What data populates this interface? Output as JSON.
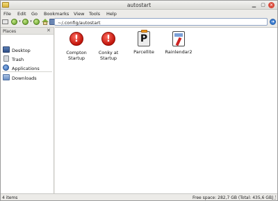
{
  "window": {
    "title": "autostart"
  },
  "menubar": [
    "File",
    "Edit",
    "Go",
    "Bookmarks",
    "View",
    "Tools",
    "Help"
  ],
  "toolbar": {
    "path": "~/.config/autostart"
  },
  "sidebar": {
    "header": "Places",
    "items": [
      {
        "label": "Desktop",
        "icon": "desktop-icon"
      },
      {
        "label": "Trash",
        "icon": "trash-icon"
      },
      {
        "label": "Applications",
        "icon": "applications-icon"
      },
      {
        "label": "Downloads",
        "icon": "downloads-folder-icon"
      }
    ]
  },
  "files": [
    {
      "label_line1": "Compton",
      "label_line2": "Startup",
      "icon": "warning-icon"
    },
    {
      "label_line1": "Conky at",
      "label_line2": "Startup",
      "icon": "warning-icon"
    },
    {
      "label_line1": "Parcellite",
      "label_line2": "",
      "icon": "parcellite-icon"
    },
    {
      "label_line1": "Rainlendar2",
      "label_line2": "",
      "icon": "rainlendar-icon"
    }
  ],
  "status": {
    "items": "4 items",
    "free_space": "Free space: 282,7 GB (Total: 435,6 GB)"
  },
  "colors": {
    "accent": "#3e7ed0",
    "warning": "#c0140a"
  }
}
